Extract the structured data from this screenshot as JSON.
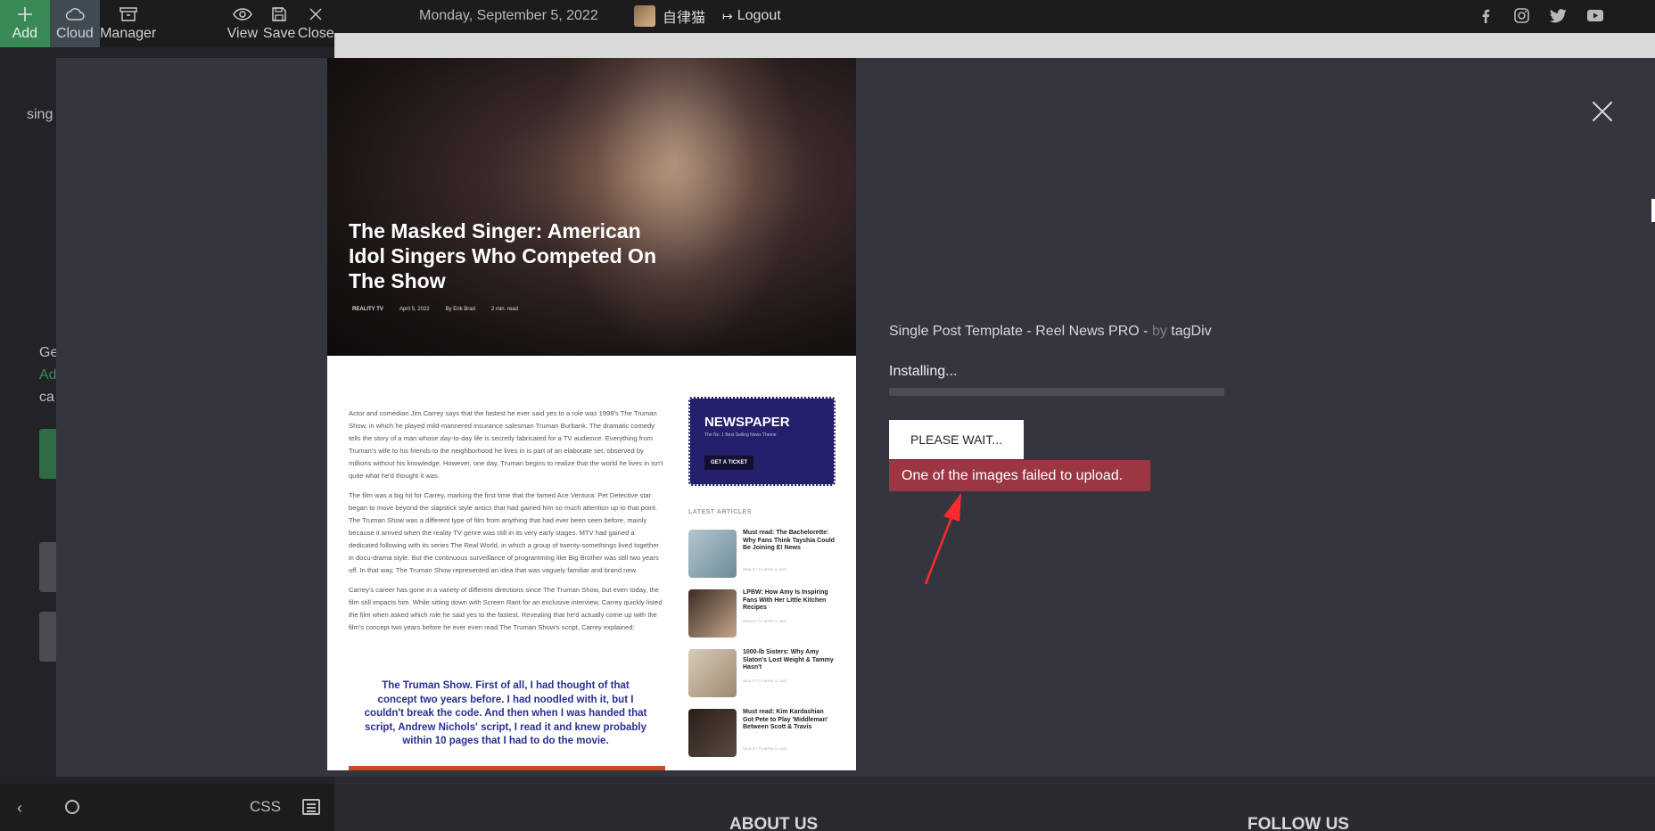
{
  "toolbar": {
    "add_label": "Add",
    "cloud_label": "Cloud",
    "manager_label": "Manager",
    "view_label": "View",
    "save_label": "Save",
    "close_label": "Close"
  },
  "topbar": {
    "date": "Monday, September 5, 2022",
    "username": "自律猫",
    "logout_label": "Logout",
    "social_icons": [
      "facebook-icon",
      "instagram-icon",
      "twitter-icon",
      "youtube-icon"
    ]
  },
  "left_panel": {
    "text_partial": "sing",
    "line1": "Ge",
    "line2": "Add",
    "line3": "ca"
  },
  "modal": {
    "template_name": "Single Post Template - Reel News PRO - ",
    "by": "by",
    "author": "tagDiv",
    "status": "Installing...",
    "progress_percent": 100,
    "wait_button_label": "PLEASE WAIT...",
    "error_message": "One of the images failed to upload."
  },
  "preview": {
    "title": "The Masked Singer: American Idol Singers Who Competed On The Show",
    "category": "REALITY TV",
    "date": "April 5, 2022",
    "author": "By Erik Brad",
    "read_time": "2 min. read",
    "paragraphs": [
      "Actor and comedian Jim Carrey says that the fastest he ever said yes to a role was 1998's The Truman Show, in which he played mild-mannered insurance salesman Truman Burbank. The dramatic comedy tells the story of a man whose day-to-day life is secretly fabricated for a TV audience. Everything from Truman's wife to his friends to the neighborhood he lives in is part of an elaborate set, observed by millions without his knowledge. However, one day, Truman begins to realize that the world he lives in isn't quite what he'd thought it was.",
      "The film was a big hit for Carrey, marking the first time that the famed Ace Ventura: Pet Detective star began to move beyond the slapstick style antics that had gained him so much attention up to that point. The Truman Show was a different type of film from anything that had ever been seen before, mainly because it arrived when the reality TV genre was still in its very early stages. MTV had gained a dedicated following with its series The Real World, in which a group of twenty-somethings lived together in docu-drama style. But the continuous surveillance of programming like Big Brother was still two years off. In that way, The Truman Show represented an idea that was vaguely familiar and brand new.",
      "Carrey's career has gone in a variety of different directions since The Truman Show, but even today, the film still impacts him. While sitting down with Screen Rant for an exclusive interview, Carrey quickly listed the film when asked which role he said yes to the fastest. Revealing that he'd actually come up with the film's concept two years before he ever even read The Truman Show's script, Carrey explained:"
    ],
    "quote": "The Truman Show. First of all, I had thought of that concept two years before. I had noodled with it, but I couldn't break the code. And then when I was handed that script, Andrew Nichols' script, I read it and knew probably within 10 pages that I had to do the movie.",
    "ad": {
      "title": "NEWSPAPER",
      "subtitle": "The No. 1 Best Selling News Theme",
      "button": "GET A TICKET"
    },
    "latest_heading": "LATEST ARTICLES",
    "latest": [
      {
        "title": "Must read: The Bachelorette: Why Fans Think Tayshia Could Be Joining E! News",
        "meta": "REALITY TV   APRIL 5, 2022"
      },
      {
        "title": "LPBW: How Amy Is Inspiring Fans With Her Little Kitchen Recipes",
        "meta": "REALITY TV   APRIL 5, 2022"
      },
      {
        "title": "1000-lb Sisters: Why Amy Slaton's Lost Weight & Tammy Hasn't",
        "meta": "REALITY TV   APRIL 5, 2022"
      },
      {
        "title": "Must read: Kim Kardashian Got Pete to Play 'Middleman' Between Scott & Travis",
        "meta": "REALITY TV   APRIL 5, 2022"
      }
    ]
  },
  "bottombar": {
    "css_label": "CSS"
  },
  "footer": {
    "about": "ABOUT US",
    "follow": "FOLLOW US"
  }
}
